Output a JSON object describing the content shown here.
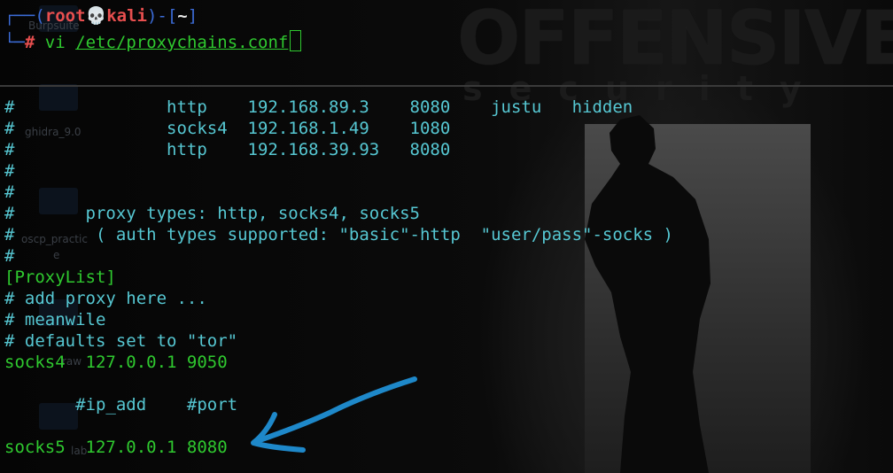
{
  "prompt": {
    "frame_left": "┌──(",
    "user": "root",
    "skull": "💀",
    "host": "kali",
    "frame_mid": ")-[",
    "dir": "~",
    "frame_right": "]",
    "frame_bottom": "└─",
    "hash": "#",
    "command": "vi",
    "path": "/etc/proxychains.conf"
  },
  "background": {
    "logo_top": "OFFENSIVE",
    "logo_bottom": "security",
    "desktop_icons": [
      "Burpsuite",
      "ghidra_9.0",
      "oscp_practic",
      "e",
      "raw",
      "lab"
    ]
  },
  "file_lines": [
    {
      "text": "#               http    192.168.89.3    8080    justu   hidden",
      "color": "cyan"
    },
    {
      "text": "#               socks4  192.168.1.49    1080",
      "color": "cyan"
    },
    {
      "text": "#               http    192.168.39.93   8080",
      "color": "cyan"
    },
    {
      "text": "#",
      "color": "cyan"
    },
    {
      "text": "#",
      "color": "cyan"
    },
    {
      "text": "#       proxy types: http, socks4, socks5",
      "color": "cyan"
    },
    {
      "text": "#        ( auth types supported: \"basic\"-http  \"user/pass\"-socks )",
      "color": "cyan"
    },
    {
      "text": "#",
      "color": "cyan"
    },
    {
      "text": "[ProxyList]",
      "color": "green"
    },
    {
      "text": "# add proxy here ...",
      "color": "cyan"
    },
    {
      "text": "# meanwile",
      "color": "cyan"
    },
    {
      "text": "# defaults set to \"tor\"",
      "color": "cyan"
    },
    {
      "text": "socks4  127.0.0.1 9050",
      "color": "green"
    },
    {
      "text": "",
      "color": "cyan"
    },
    {
      "text": "       #ip_add    #port",
      "color": "cyan"
    },
    {
      "text": "",
      "color": "cyan"
    },
    {
      "text": "socks5  127.0.0.1 8080",
      "color": "green"
    }
  ],
  "colors": {
    "cyan": "#56c7d2",
    "green": "#2fc92f",
    "prompt_red": "#e84f4f",
    "prompt_blue": "#3b6bd6",
    "annotation_arrow": "#1e88c9"
  },
  "annotation": {
    "icon": "hand-drawn-arrow-icon"
  }
}
